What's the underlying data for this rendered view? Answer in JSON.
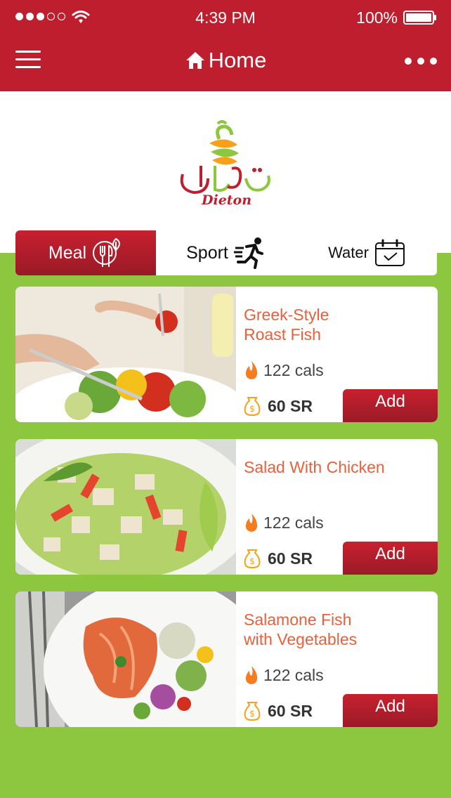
{
  "status_bar": {
    "time": "4:39 PM",
    "battery": "100%"
  },
  "nav": {
    "title": "Home"
  },
  "brand": {
    "logo_text": "Dieton",
    "accent_red": "#bf1e2e",
    "accent_green": "#8dc63f",
    "accent_orange": "#e8603c"
  },
  "tabs": [
    {
      "label": "Meal",
      "icon": "meal-fork-leaf-icon",
      "active": true
    },
    {
      "label": "Sport",
      "icon": "runner-icon",
      "active": false
    },
    {
      "label": "Water",
      "icon": "calendar-check-icon",
      "active": false
    }
  ],
  "meals": [
    {
      "name_line1": "Greek-Style",
      "name_line2": "Roast Fish",
      "calories": "122 cals",
      "price": "60 SR",
      "add_label": "Add",
      "image_icon": "salad-fork-photo"
    },
    {
      "name_line1": "Salad With Chicken",
      "name_line2": "",
      "calories": "122 cals",
      "price": "60 SR",
      "add_label": "Add",
      "image_icon": "chicken-salad-photo"
    },
    {
      "name_line1": "Salamone Fish",
      "name_line2": "with Vegetables",
      "calories": "122 cals",
      "price": "60 SR",
      "add_label": "Add",
      "image_icon": "salmon-plate-photo"
    }
  ]
}
